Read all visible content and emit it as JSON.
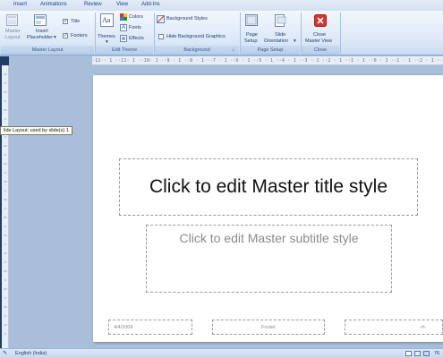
{
  "ribbon_tabs": [
    "Insert",
    "Animations",
    "Review",
    "View",
    "Add-Ins"
  ],
  "master_layout": {
    "group_label": "Master Layout",
    "master_layout_button": [
      "Master",
      "Layout"
    ],
    "insert_placeholder_button": [
      "Insert",
      "Placeholder"
    ],
    "title_checkbox": {
      "label": "Title",
      "checked": true
    },
    "footers_checkbox": {
      "label": "Footers",
      "checked": true
    }
  },
  "edit_theme": {
    "group_label": "Edit Theme",
    "themes_button": "Themes",
    "colors_button": "Colors",
    "fonts_button": "Fonts",
    "effects_button": "Effects"
  },
  "background": {
    "group_label": "Background",
    "background_styles_button": "Background Styles",
    "hide_background_graphics": {
      "label": "Hide Background Graphics",
      "checked": false
    }
  },
  "page_setup": {
    "group_label": "Page Setup",
    "page_setup_button": [
      "Page",
      "Setup"
    ],
    "slide_orientation_button": [
      "Slide",
      "Orientation"
    ]
  },
  "close": {
    "group_label": "Close",
    "close_master_view_button": [
      "Close",
      "Master View"
    ]
  },
  "ruler": {
    "top_marks": "·12·· 1 ··11· 1 ··10· 1 ··9 · 1 ··8 · 1 ··7 · 1 ··6 · 1 ··5 · 1 ··4 · 1 ··3 · 1 ··2 · 1 ··1 · 1 ··0 · 1 ··1 · 1 ··2 · 1 ··3 · 1 ··4 · 1 ··5 · 1 ··6 · 1 ··7 · 1 ··8 · 1 ··9 · 1 ··10· 1 ··11· 1 ··12·"
  },
  "tooltip": "lide Layout: used by slide(s) 1",
  "slide": {
    "title_placeholder": "Click to edit Master title style",
    "subtitle_placeholder": "Click to edit Master subtitle style",
    "date": "4/4/2009",
    "footer": "Footer",
    "slide_number": "‹#›"
  },
  "status_bar": {
    "language": "English (India)",
    "zoom": "76"
  },
  "colors": {
    "ribbon_text": "#15428b",
    "close_red": "#d9342b",
    "left_pane": "#1f3d66"
  }
}
